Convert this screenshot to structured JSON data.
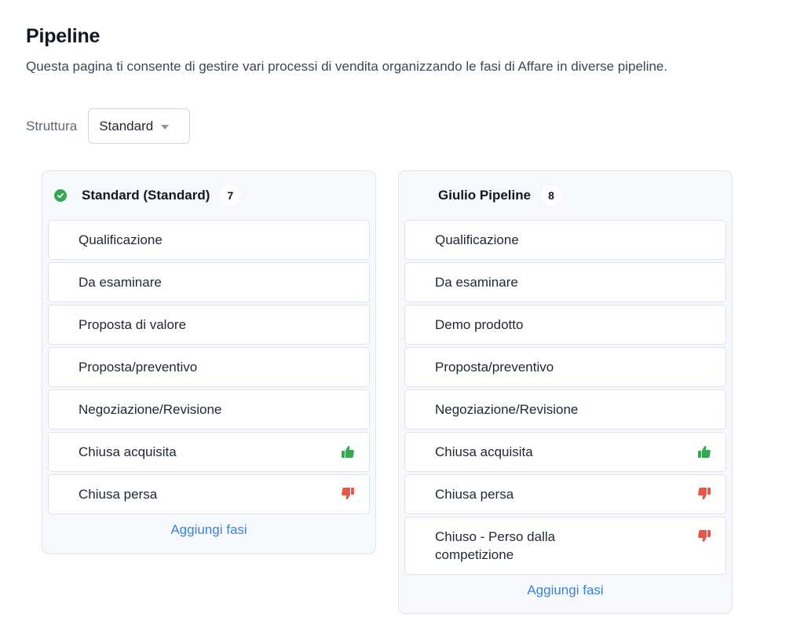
{
  "header": {
    "title": "Pipeline",
    "description": "Questa pagina ti consente di gestire vari processi di vendita organizzando le fasi di Affare in diverse pipeline."
  },
  "structure": {
    "label": "Struttura",
    "selected": "Standard"
  },
  "pipelines": [
    {
      "name": "Standard (Standard)",
      "count": "7",
      "is_default": true,
      "add_label": "Aggiungi fasi",
      "stages": [
        {
          "label": "Qualificazione",
          "icon": ""
        },
        {
          "label": "Da esaminare",
          "icon": ""
        },
        {
          "label": "Proposta di valore",
          "icon": ""
        },
        {
          "label": "Proposta/preventivo",
          "icon": ""
        },
        {
          "label": "Negoziazione/Revisione",
          "icon": ""
        },
        {
          "label": "Chiusa acquisita",
          "icon": "thumbs-up-icon"
        },
        {
          "label": "Chiusa persa",
          "icon": "thumbs-down-icon"
        }
      ]
    },
    {
      "name": "Giulio Pipeline",
      "count": "8",
      "is_default": false,
      "add_label": "Aggiungi fasi",
      "stages": [
        {
          "label": "Qualificazione",
          "icon": ""
        },
        {
          "label": "Da esaminare",
          "icon": ""
        },
        {
          "label": "Demo prodotto",
          "icon": ""
        },
        {
          "label": "Proposta/preventivo",
          "icon": ""
        },
        {
          "label": "Negoziazione/Revisione",
          "icon": ""
        },
        {
          "label": "Chiusa acquisita",
          "icon": "thumbs-up-icon"
        },
        {
          "label": "Chiusa persa",
          "icon": "thumbs-down-icon"
        },
        {
          "label": "Chiuso - Perso dalla competizione",
          "icon": "thumbs-down-icon"
        }
      ]
    }
  ],
  "colors": {
    "won": "#34a853",
    "lost": "#e8574a",
    "link": "#3a83d8",
    "default_check": "#34a853"
  }
}
